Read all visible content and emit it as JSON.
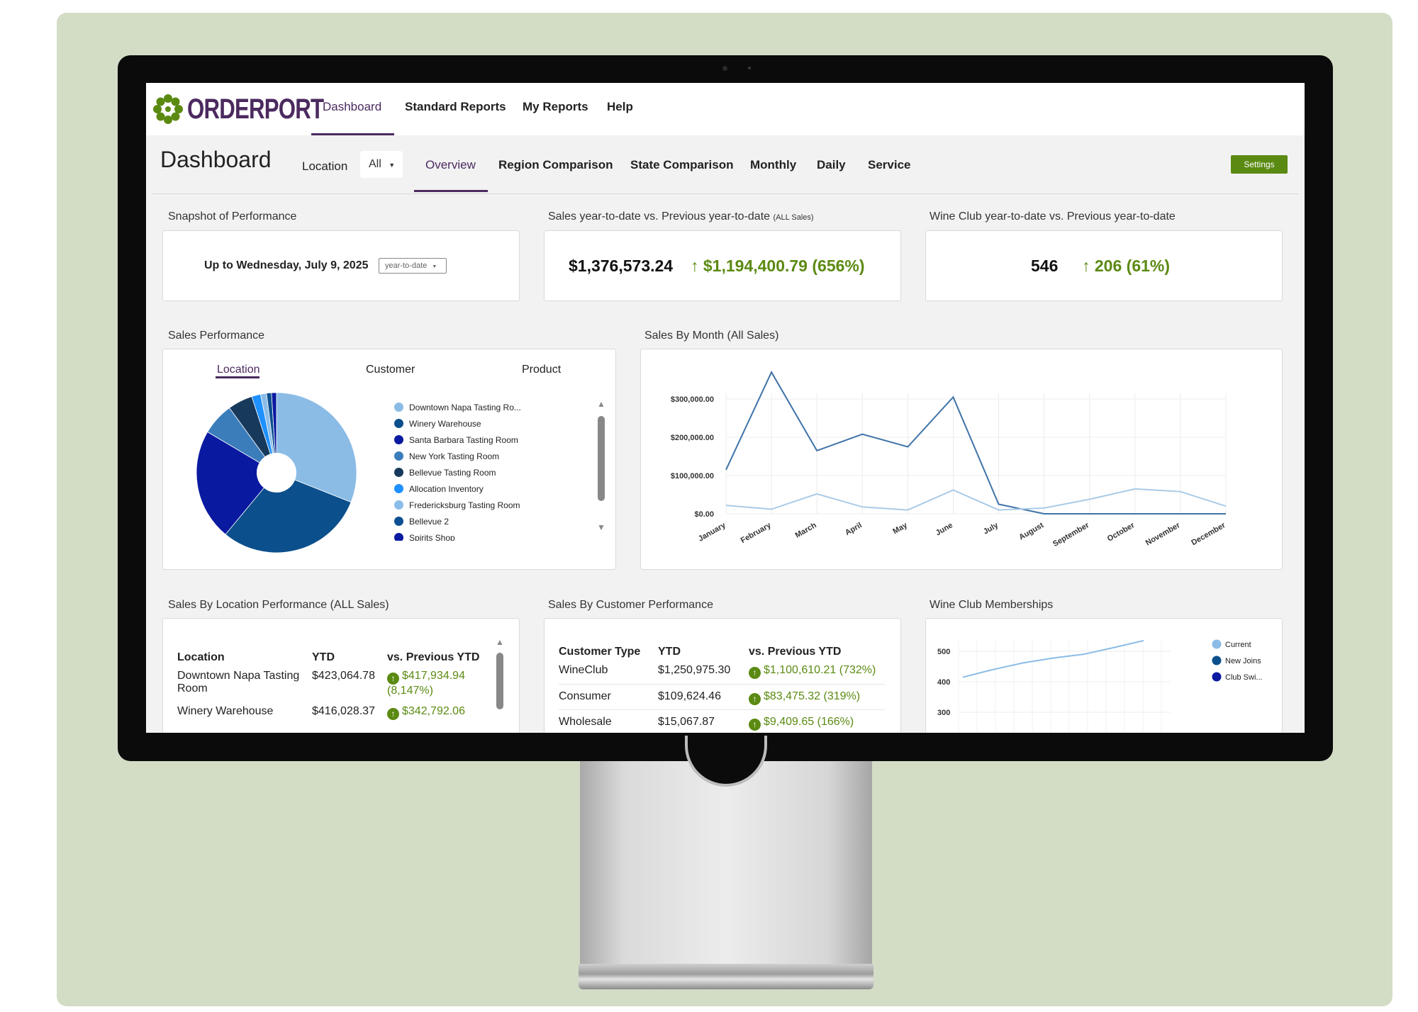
{
  "brand": {
    "name": "ORDERPORT",
    "logo_color": "#4b2a5f",
    "accent": "#5b8a12"
  },
  "nav": {
    "items": [
      {
        "label": "Dashboard",
        "active": true
      },
      {
        "label": "Standard Reports"
      },
      {
        "label": "My Reports"
      },
      {
        "label": "Help"
      }
    ]
  },
  "subbar": {
    "title": "Dashboard",
    "location_label": "Location",
    "location_value": "All",
    "tabs": [
      {
        "label": "Overview",
        "active": true
      },
      {
        "label": "Region Comparison"
      },
      {
        "label": "State Comparison"
      },
      {
        "label": "Monthly"
      },
      {
        "label": "Daily"
      },
      {
        "label": "Service"
      }
    ],
    "settings_label": "Settings"
  },
  "snapshot": {
    "title": "Snapshot of Performance",
    "date_text": "Up to Wednesday, July 9, 2025",
    "period": "year-to-date"
  },
  "sales_ytd": {
    "title": "Sales year-to-date vs. Previous year-to-date",
    "title_note": "(ALL Sales)",
    "value": "$1,376,573.24",
    "change": "$1,194,400.79 (656%)"
  },
  "wine_club_ytd": {
    "title": "Wine Club year-to-date vs. Previous year-to-date",
    "value": "546",
    "change": "206 (61%)"
  },
  "sales_performance": {
    "title": "Sales Performance",
    "tabs": [
      "Location",
      "Customer",
      "Product"
    ],
    "active_tab": "Location",
    "legend": [
      {
        "label": "Downtown Napa Tasting Ro...",
        "color": "#8bbce6"
      },
      {
        "label": "Winery Warehouse",
        "color": "#0b4f8c"
      },
      {
        "label": "Santa Barbara Tasting Room",
        "color": "#0a1aa0"
      },
      {
        "label": "New York Tasting Room",
        "color": "#3b7dbb"
      },
      {
        "label": "Bellevue Tasting Room",
        "color": "#17395c"
      },
      {
        "label": "Allocation Inventory",
        "color": "#1e90ff"
      },
      {
        "label": "Fredericksburg Tasting Room",
        "color": "#8cbde8"
      },
      {
        "label": "Bellevue 2",
        "color": "#0d4f91"
      },
      {
        "label": "Spirits Shop",
        "color": "#0a1aa0"
      }
    ],
    "pie_slices": [
      {
        "name": "Downtown Napa Tasting Ro...",
        "value": 31.0,
        "color": "#8bbce6"
      },
      {
        "name": "Winery Warehouse",
        "value": 30.0,
        "color": "#0b4f8c"
      },
      {
        "name": "Santa Barbara Tasting Room",
        "value": 22.5,
        "color": "#0a1aa0"
      },
      {
        "name": "New York Tasting Room",
        "value": 6.5,
        "color": "#3b7dbb"
      },
      {
        "name": "Bellevue Tasting Room",
        "value": 5.0,
        "color": "#17395c"
      },
      {
        "name": "Allocation Inventory",
        "value": 1.8,
        "color": "#1e90ff"
      },
      {
        "name": "Fredericksburg Tasting Room",
        "value": 1.2,
        "color": "#8cbde8"
      },
      {
        "name": "Bellevue 2",
        "value": 1.0,
        "color": "#0d4f91"
      },
      {
        "name": "Spirits Shop",
        "value": 1.0,
        "color": "#0a1aa0"
      }
    ]
  },
  "sales_by_month": {
    "title": "Sales By Month (All Sales)",
    "chart_data": {
      "type": "line",
      "categories": [
        "January",
        "February",
        "March",
        "April",
        "May",
        "June",
        "July",
        "August",
        "September",
        "October",
        "November",
        "December"
      ],
      "y_ticks": [
        "$0.00",
        "$100,000.00",
        "$200,000.00",
        "$300,000.00"
      ],
      "ylim": [
        0,
        300000
      ],
      "series": [
        {
          "values": [
            115000,
            370000,
            165000,
            208000,
            175000,
            305000,
            25000,
            0,
            0,
            0,
            0,
            0
          ],
          "color": "#3f73a8"
        },
        {
          "values": [
            22000,
            12000,
            52000,
            18000,
            10000,
            62000,
            10000,
            15000,
            38000,
            65000,
            58000,
            20000
          ],
          "color": "#a9cbe8"
        }
      ]
    }
  },
  "location_perf": {
    "title": "Sales By Location Performance (ALL Sales)",
    "headers": {
      "location": "Location",
      "ytd": "YTD",
      "prev": "vs. Previous YTD"
    },
    "rows": [
      {
        "location": "Downtown Napa Tasting Room",
        "ytd": "$423,064.78",
        "change": "$417,934.94 (8,147%)"
      },
      {
        "location": "Winery Warehouse",
        "ytd": "$416,028.37",
        "change": "$342,792.06"
      }
    ]
  },
  "customer_perf": {
    "title": "Sales By Customer Performance",
    "headers": {
      "type": "Customer Type",
      "ytd": "YTD",
      "prev": "vs. Previous YTD"
    },
    "rows": [
      {
        "type": "WineClub",
        "ytd": "$1,250,975.30",
        "change": "$1,100,610.21 (732%)"
      },
      {
        "type": "Consumer",
        "ytd": "$109,624.46",
        "change": "$83,475.32 (319%)"
      },
      {
        "type": "Wholesale",
        "ytd": "$15,067.87",
        "change": "$9,409.65 (166%)"
      }
    ]
  },
  "wine_club_memberships": {
    "title": "Wine Club Memberships",
    "chart_data": {
      "type": "line",
      "y_ticks": [
        "500",
        "400",
        "300"
      ],
      "ylim": [
        300,
        500
      ],
      "legend": [
        {
          "label": "Current",
          "color": "#8bbce6"
        },
        {
          "label": "New Joins",
          "color": "#0b4f8c"
        },
        {
          "label": "Club Swi...",
          "color": "#0a1aa0"
        }
      ],
      "series": [
        {
          "name": "Current",
          "values": [
            415,
            440,
            462,
            478,
            490,
            512,
            535
          ],
          "color": "#8bbce6"
        }
      ]
    }
  }
}
